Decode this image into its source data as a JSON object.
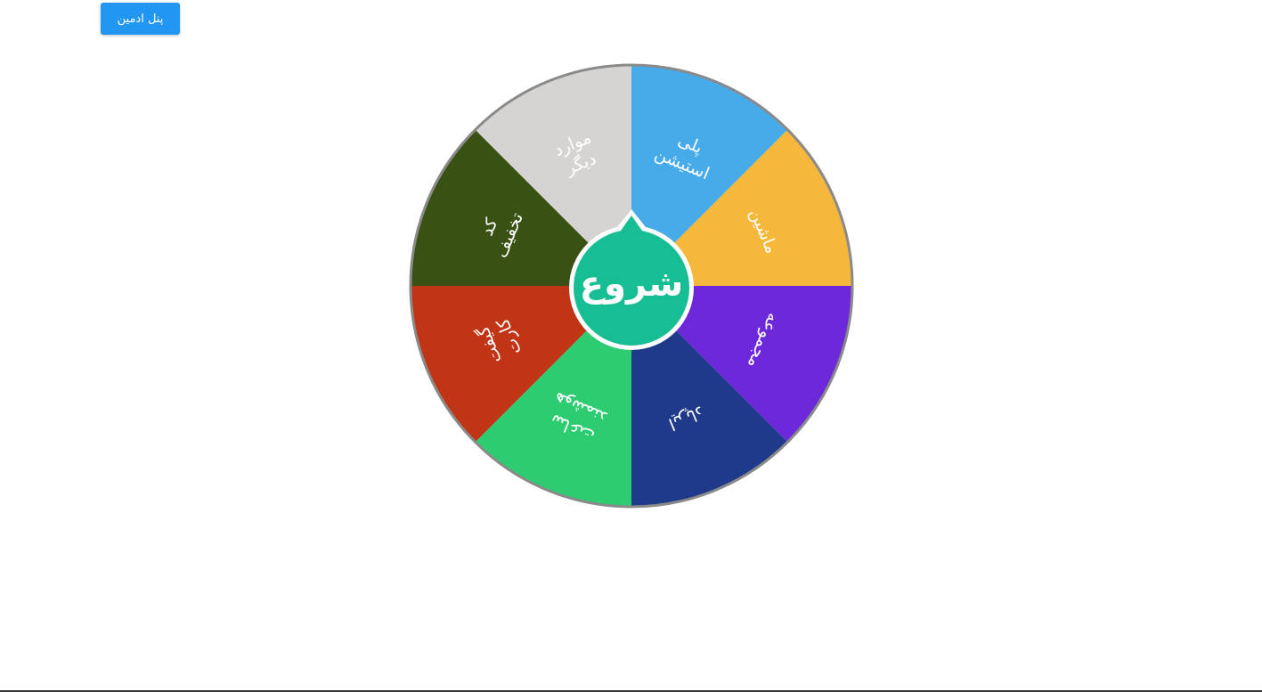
{
  "header": {
    "admin_button_label": "پنل ادمین"
  },
  "wheel": {
    "start_label": "شروع",
    "border_color": "#8a8a8a",
    "center_color": "#17be94",
    "center_border_color": "#ffffff",
    "segments": [
      {
        "label_lines": [
          "پلی",
          "استیشن"
        ],
        "color": "#47abe9"
      },
      {
        "label_lines": [
          "ماشین"
        ],
        "color": "#f6b83b"
      },
      {
        "label_lines": [
          "مجموعه"
        ],
        "color": "#6d28d9"
      },
      {
        "label_lines": [
          "ایرپاد"
        ],
        "color": "#1f3a8a"
      },
      {
        "label_lines": [
          "ساعت",
          "هوشمند"
        ],
        "color": "#2ecc71"
      },
      {
        "label_lines": [
          "گیفت",
          "کارت"
        ],
        "color": "#c03516"
      },
      {
        "label_lines": [
          "کد",
          "تخفیف"
        ],
        "color": "#395112"
      },
      {
        "label_lines": [
          "موارد",
          "دیگر"
        ],
        "color": "#d6d4d2"
      }
    ]
  }
}
